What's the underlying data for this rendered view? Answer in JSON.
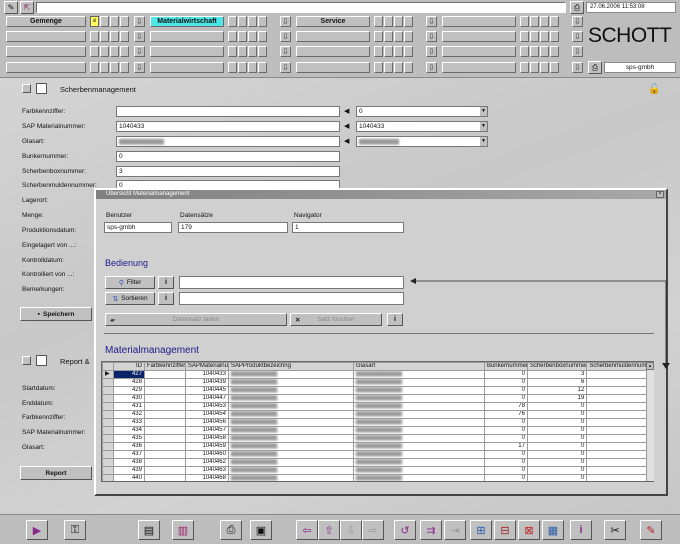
{
  "header": {
    "menu_row": [
      {
        "label": "Gemenge",
        "marker": "sl"
      },
      {
        "label": "Materialwirtschaft",
        "highlight": true
      },
      {
        "label": "Service"
      },
      {
        "label": ""
      }
    ],
    "datetime": "27.06.2006 11:53:08",
    "brand": "SCHOTT",
    "user": "sps-gmbh"
  },
  "page": {
    "title": "Scherbenmanagement",
    "report_title": "Report &"
  },
  "form": {
    "farbkennziffer_label": "Farbkennziffer:",
    "sap_label": "SAP Materialnummer:",
    "glasart_label": "Glasart:",
    "bunker_label": "Bunkernummer:",
    "scherbenbox_label": "Scherbenboxnummer:",
    "scherbenmulden_label": "Scherbenmuldennummer:",
    "lagerort_label": "Lagerort:",
    "menge_label": "Menge:",
    "produktionsdatum_label": "Produktionsdatum:",
    "eingelagert_label": "Eingelagert von ...:",
    "kontrolldatum_label": "Kontrolldatum:",
    "kontrolliert_label": "Kontrolliert von ...:",
    "bemerkungen_label": "Bemerkungen:",
    "sap_value": "1040433",
    "farb_select": "0",
    "sap_select": "1040433",
    "bunker_value": "0",
    "scherbenbox_value": "3",
    "scherbenmulden_value": "0",
    "save_label": "Speichern"
  },
  "report": {
    "startdatum_label": "Startdatum:",
    "enddatum_label": "Enddatum:",
    "farb_label": "Farbkennziffer:",
    "sap_label": "SAP Materialnummer:",
    "glasart_label": "Glasart:",
    "button_label": "Report"
  },
  "dialog": {
    "title": "Übersicht Materialmanagement",
    "benutzer_label": "Benutzer",
    "benutzer_value": "sps-gmbh",
    "datensaetze_label": "Datensätze",
    "datensaetze_value": "179",
    "navigator_label": "Navigator",
    "navigator_value": "1",
    "bedienung_heading": "Bedienung",
    "filter_label": "Filter",
    "sortieren_label": "Sortieren",
    "datensatz_laden_label": "Datensatz laden",
    "satz_loeschen_label": "Satz löschen",
    "material_heading": "Materialmanagement",
    "columns": [
      "ID",
      "Farbkennziffer",
      "SAPMaterialnummer",
      "SAPProduktbezeichng",
      "Glasart",
      "Bunkernummer",
      "Scherbenboxnummer",
      "Scherbenmuldennumr"
    ],
    "rows": [
      {
        "id": "427",
        "sap": "1040433",
        "bunker": "0",
        "box": "3"
      },
      {
        "id": "428",
        "sap": "1040439",
        "bunker": "0",
        "box": "6"
      },
      {
        "id": "429",
        "sap": "1040445",
        "bunker": "0",
        "box": "12"
      },
      {
        "id": "430",
        "sap": "1040447",
        "bunker": "0",
        "box": "19"
      },
      {
        "id": "431",
        "sap": "1040453",
        "bunker": "78",
        "box": "0"
      },
      {
        "id": "432",
        "sap": "1040454",
        "bunker": "76",
        "box": "0"
      },
      {
        "id": "433",
        "sap": "1040456",
        "bunker": "0",
        "box": "0"
      },
      {
        "id": "434",
        "sap": "1040457",
        "bunker": "0",
        "box": "0"
      },
      {
        "id": "435",
        "sap": "1040458",
        "bunker": "0",
        "box": "0"
      },
      {
        "id": "436",
        "sap": "1040459",
        "bunker": "17",
        "box": "0"
      },
      {
        "id": "437",
        "sap": "1040460",
        "bunker": "0",
        "box": "0"
      },
      {
        "id": "438",
        "sap": "1040462",
        "bunker": "0",
        "box": "0"
      },
      {
        "id": "439",
        "sap": "1040463",
        "bunker": "0",
        "box": "0"
      },
      {
        "id": "440",
        "sap": "1040468",
        "bunker": "0",
        "box": "0"
      }
    ]
  }
}
